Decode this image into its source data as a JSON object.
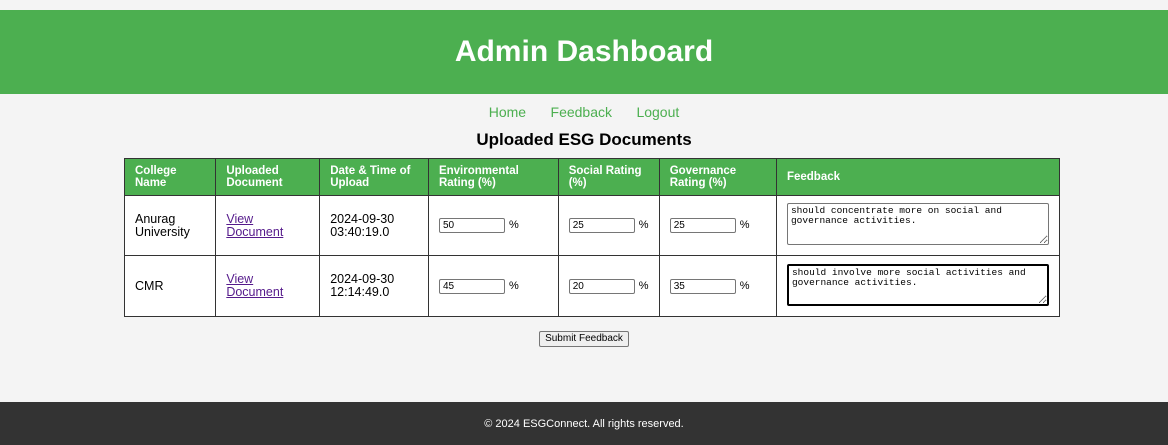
{
  "header": {
    "title": "Admin Dashboard"
  },
  "nav": {
    "items": [
      "Home",
      "Feedback",
      "Logout"
    ]
  },
  "section_title": "Uploaded ESG Documents",
  "table": {
    "headers": [
      "College Name",
      "Uploaded Document",
      "Date & Time of Upload",
      "Environmental Rating (%)",
      "Social Rating (%)",
      "Governance Rating (%)",
      "Feedback"
    ],
    "rows": [
      {
        "college": "Anurag University",
        "document": "View Document",
        "date": "2024-09-30",
        "time": "03:40:19.0",
        "environmental": "50",
        "social": "25",
        "governance": "25",
        "pct": "%",
        "feedback": "should concentrate more on social and governance activities."
      },
      {
        "college": "CMR",
        "document": "View Document",
        "date": "2024-09-30",
        "time": "12:14:49.0",
        "environmental": "45",
        "social": "20",
        "governance": "35",
        "pct": "%",
        "feedback": "should involve more social activities and governance activities."
      }
    ]
  },
  "submit_label": "Submit Feedback",
  "footer": {
    "text": "© 2024 ESGConnect. All rights reserved."
  },
  "colors": {
    "brand": "#4caf50",
    "footer_bg": "#333333",
    "link_visited": "#551a8b"
  }
}
